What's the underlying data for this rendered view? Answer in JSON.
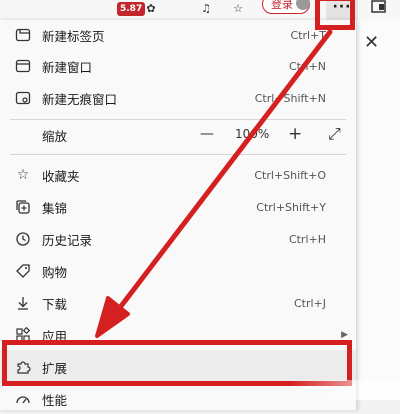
{
  "toolbar": {
    "badge": "5.87",
    "login_label": "登录",
    "more_label": "···"
  },
  "menu": {
    "items": [
      {
        "label": "新建标签页",
        "shortcut": "Ctrl+T",
        "icon": "new-tab-icon"
      },
      {
        "label": "新建窗口",
        "shortcut": "Ctrl+N",
        "icon": "window-icon"
      },
      {
        "label": "新建无痕窗口",
        "shortcut": "Ctrl+Shift+N",
        "icon": "inprivate-icon"
      },
      {
        "label": "缩放",
        "shortcut": "",
        "icon": ""
      },
      {
        "label": "收藏夹",
        "shortcut": "Ctrl+Shift+O",
        "icon": "favorites-icon"
      },
      {
        "label": "集锦",
        "shortcut": "Ctrl+Shift+Y",
        "icon": "collections-icon"
      },
      {
        "label": "历史记录",
        "shortcut": "Ctrl+H",
        "icon": "history-icon"
      },
      {
        "label": "购物",
        "shortcut": "",
        "icon": "shopping-tag-icon"
      },
      {
        "label": "下载",
        "shortcut": "Ctrl+J",
        "icon": "download-icon"
      },
      {
        "label": "应用",
        "shortcut": "",
        "icon": "apps-icon"
      },
      {
        "label": "扩展",
        "shortcut": "",
        "icon": "extensions-icon"
      },
      {
        "label": "性能",
        "shortcut": "",
        "icon": "performance-icon"
      }
    ],
    "zoom": {
      "minus": "—",
      "value": "100%",
      "plus": "+",
      "fullscreen": "⤢"
    }
  },
  "annotations": {
    "highlight_color": "#d42020"
  }
}
